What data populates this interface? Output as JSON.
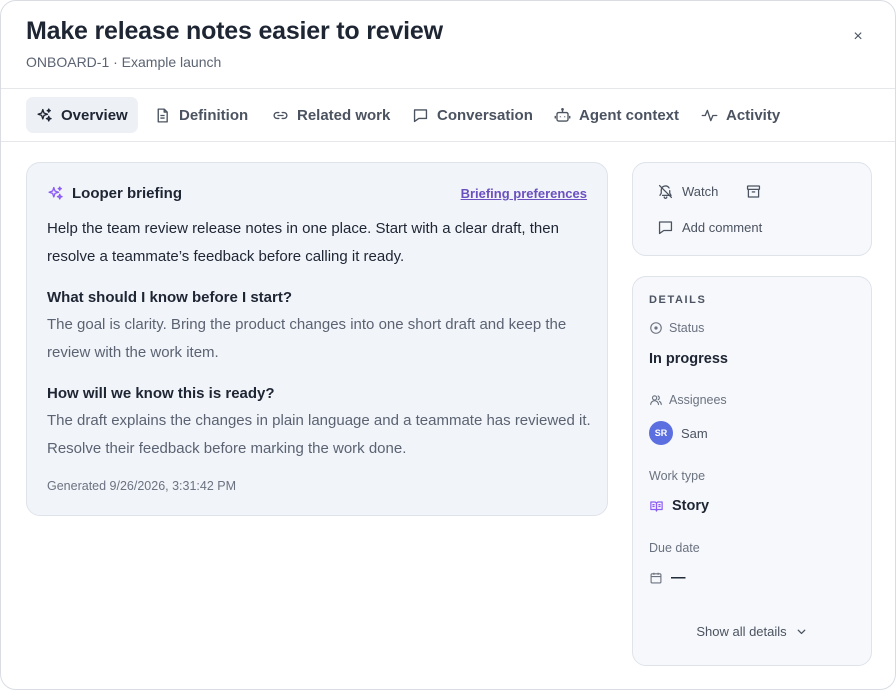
{
  "header": {
    "title": "Make release notes easier to review",
    "subtitle": "ONBOARD-1 · Example launch",
    "close_glyph": "×"
  },
  "tabs": [
    {
      "label": "Overview",
      "icon": "sparkles-icon",
      "active": true
    },
    {
      "label": "Definition",
      "icon": "document-icon"
    },
    {
      "label": "Related work",
      "icon": "link-icon"
    },
    {
      "label": "Conversation",
      "icon": "chat-icon"
    },
    {
      "label": "Agent context",
      "icon": "robot-icon"
    },
    {
      "label": "Activity",
      "icon": "activity-icon"
    }
  ],
  "briefing": {
    "title": "Looper briefing",
    "preferences_link": "Briefing preferences",
    "summary": "Help the team review release notes in one place. Start with a clear draft, then resolve a teammate’s feedback before calling it ready.",
    "q1": "What should I know before I start?",
    "a1": "The goal is clarity. Bring the product changes into one short draft and keep the review with the work item.",
    "q2": "How will we know this is ready?",
    "a2": "The draft explains the changes in plain language and a teammate has reviewed it. Resolve their feedback before marking the work done.",
    "generated": "Generated 9/26/2026, 3:31:42 PM"
  },
  "actions": {
    "watch": "Watch",
    "add_comment": "Add comment"
  },
  "details": {
    "section_title": "DETAILS",
    "status_label": "Status",
    "status_value": "In progress",
    "assignees_label": "Assignees",
    "assignee_initials": "SR",
    "assignee_name": "Sam",
    "work_type_label": "Work type",
    "work_type_value": "Story",
    "due_date_label": "Due date",
    "due_date_value": "—",
    "show_all": "Show all details"
  },
  "colors": {
    "accent_purple": "#6b4fc0",
    "avatar_blue": "#5b6fe0",
    "story_purple": "#8b5cf6"
  }
}
